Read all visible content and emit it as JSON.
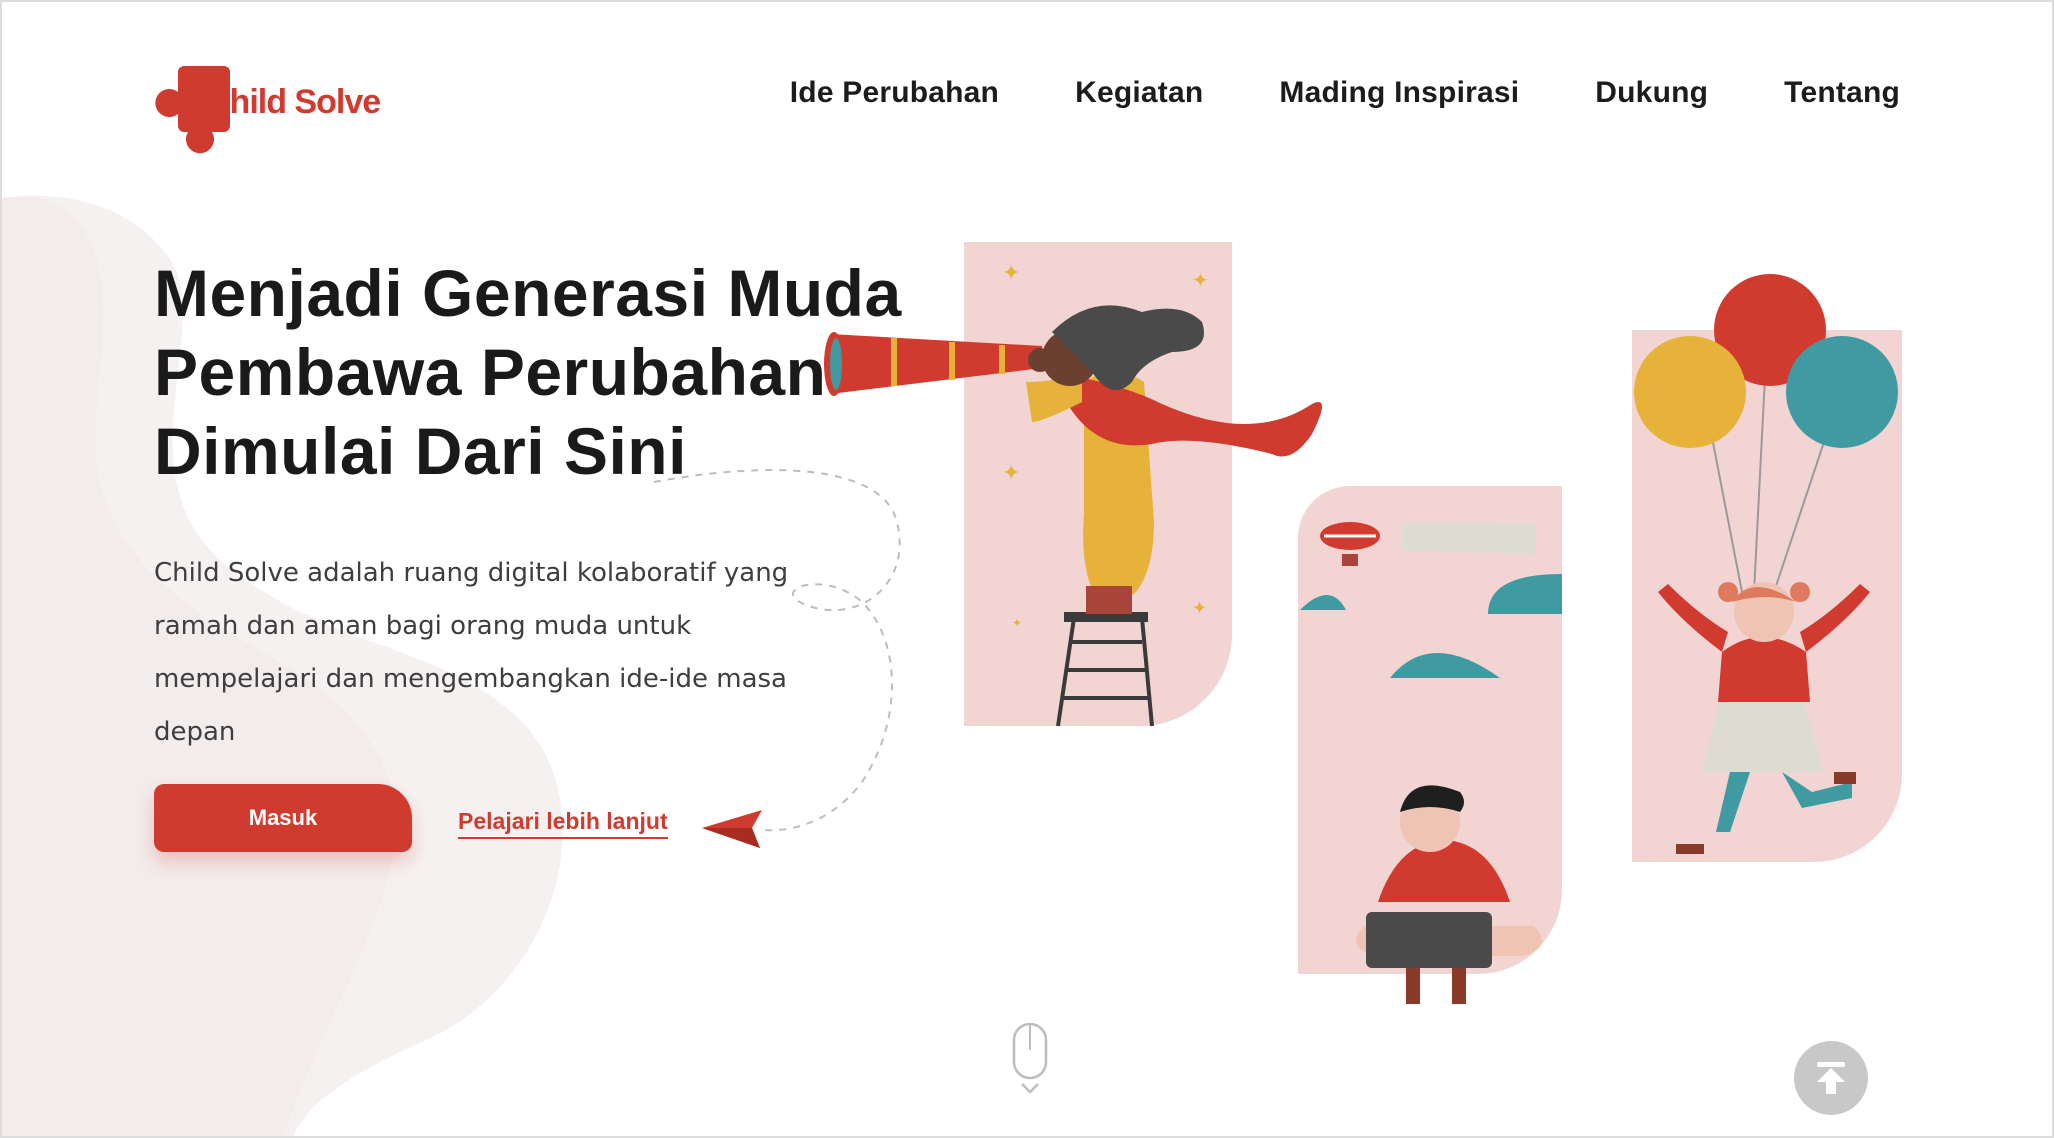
{
  "brand": {
    "name": "Child Solve",
    "accent": "#cf3b2e"
  },
  "nav": {
    "items": [
      "Ide Perubahan",
      "Kegiatan",
      "Mading Inspirasi",
      "Dukung",
      "Tentang"
    ]
  },
  "hero": {
    "title_lines": [
      "Menjadi Generasi Muda",
      "Pembawa Perubahan",
      "Dimulai Dari Sini"
    ],
    "description": "Child Solve adalah ruang digital kolaboratif yang ramah dan aman bagi orang muda untuk mempelajari dan mengembangkan ide-ide masa depan",
    "primary_button": "Masuk",
    "secondary_link": "Pelajari lebih lanjut"
  },
  "icons": {
    "logo": "puzzle-piece-logo",
    "scroll_hint": "mouse-scroll-icon",
    "back_to_top": "arrow-up-to-line-icon",
    "paper_plane": "paper-plane-icon"
  },
  "colors": {
    "panel_pink": "#f2d4d3",
    "red": "#cf3b2e",
    "yellow": "#e7b23a",
    "teal": "#3f9aa2",
    "text_dark": "#1c1c1c",
    "background_blob": "#f6f1f1"
  }
}
